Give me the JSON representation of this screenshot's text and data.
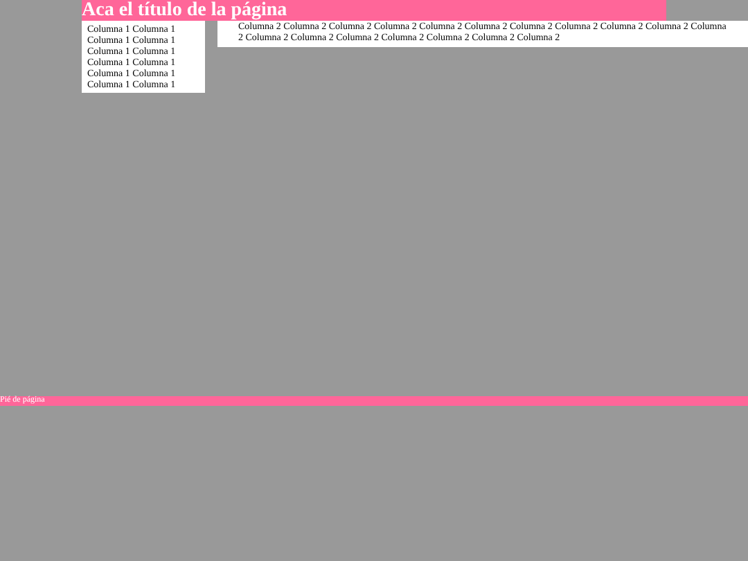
{
  "header": {
    "title": "Aca el título de la página"
  },
  "column_1": {
    "lines": [
      "Columna 1 Columna 1",
      "Columna 1 Columna 1",
      "Columna 1 Columna 1",
      "Columna 1 Columna 1",
      "Columna 1 Columna 1",
      "Columna 1 Columna 1"
    ]
  },
  "column_2": {
    "text": "Columna 2 Columna 2 Columna 2 Columna 2 Columna 2 Columna 2 Columna 2 Columna 2 Columna 2 Columna 2 Columna 2 Columna 2 Columna 2 Columna 2 Columna 2 Columna 2 Columna 2 Columna 2"
  },
  "footer": {
    "text": "Pié de página"
  }
}
